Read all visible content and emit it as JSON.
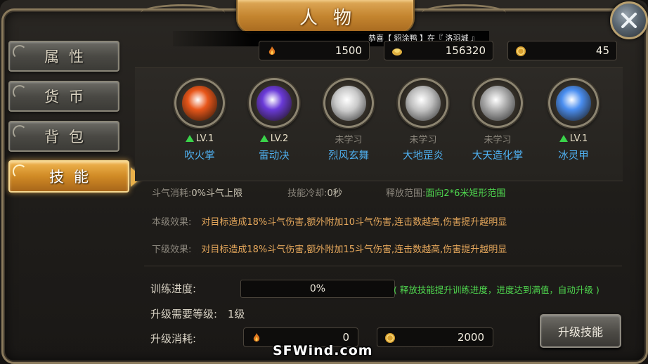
{
  "window": {
    "title": "人物"
  },
  "sidebar": {
    "tabs": [
      {
        "label": "属性"
      },
      {
        "label": "货币"
      },
      {
        "label": "背包"
      },
      {
        "label": "技能"
      }
    ],
    "active_tab": "技能"
  },
  "notice": "恭喜【 貂涂鸭 】在『 洛羽城 』",
  "currencies": [
    {
      "icon": "flame-coin-icon",
      "value": "1500"
    },
    {
      "icon": "ingot-icon",
      "value": "156320"
    },
    {
      "icon": "gold-coin-icon",
      "value": "45"
    }
  ],
  "skills": [
    {
      "name": "吹火掌",
      "level": "LV.1",
      "learned": true,
      "orb_color": "#e8561a"
    },
    {
      "name": "雷动决",
      "level": "LV.2",
      "learned": true,
      "orb_color": "#6a3ad8"
    },
    {
      "name": "烈风玄舞",
      "level": "未学习",
      "learned": false,
      "orb_color": "#c9c9c9"
    },
    {
      "name": "大地罡炎",
      "level": "未学习",
      "learned": false,
      "orb_color": "#bdbdbd"
    },
    {
      "name": "大天造化掌",
      "level": "未学习",
      "learned": false,
      "orb_color": "#a8a8a8"
    },
    {
      "name": "冰灵甲",
      "level": "LV.1",
      "learned": true,
      "orb_color": "#4a8ef0"
    }
  ],
  "skill_info": {
    "cost_label": "斗气消耗:",
    "cost_value": "0%斗气上限",
    "cooldown_label": "技能冷却:",
    "cooldown_value": "0秒",
    "range_label": "释放范围:",
    "range_value": "面向2*6米矩形范围",
    "current_label": "本级效果:",
    "current_effect": "对目标造成18%斗气伤害,额外附加10斗气伤害,连击数越高,伤害提升越明显",
    "next_label": "下级效果:",
    "next_effect": "对目标造成18%斗气伤害,额外附加15斗气伤害,连击数越高,伤害提升越明显"
  },
  "training": {
    "progress_label": "训练进度:",
    "progress_text": "0%",
    "progress_fraction": 0,
    "hint": "( 释放技能提升训练进度，进度达到满值，自动升级 )",
    "required_level_label": "升级需要等级:",
    "required_level_value": "1级",
    "cost_label": "升级消耗:",
    "cost_items": [
      {
        "icon": "flame-coin-icon",
        "value": "0"
      },
      {
        "icon": "gold-coin-icon",
        "value": "2000"
      }
    ]
  },
  "buttons": {
    "upgrade": "升级技能"
  },
  "watermark": "SFWind.com",
  "colors": {
    "accent": "#d08a25",
    "skill_name": "#4fb0f0",
    "effect": "#e6a85c",
    "hint": "#4fd84f"
  }
}
